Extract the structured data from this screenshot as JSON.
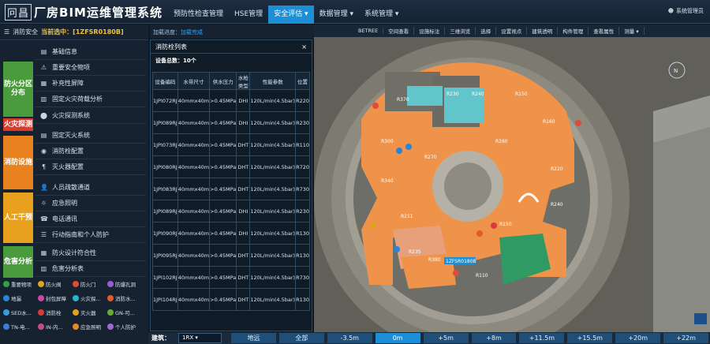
{
  "app": {
    "logo_mark": "冋昌",
    "title": "厂房BIM运维管理系统"
  },
  "nav": [
    {
      "label": "预防性检查管理"
    },
    {
      "label": "HSE管理"
    },
    {
      "label": "安全评估 ▾",
      "active": true
    },
    {
      "label": "数据管理 ▾"
    },
    {
      "label": "系统管理 ▾"
    }
  ],
  "user": {
    "label": "系统管理员"
  },
  "left": {
    "header_prefix": "消防安全",
    "current_label": "当前选中：[1ZFSR0180B]"
  },
  "categories": [
    {
      "label": "防火分区分布",
      "color": "#4a9b3c"
    },
    {
      "label": "火灾探测",
      "color": "#d83b2b"
    },
    {
      "label": "消防设施",
      "color": "#e8821f"
    },
    {
      "label": "人工干预",
      "color": "#e8a11f"
    },
    {
      "label": "危害分析",
      "color": "#4a9b3c"
    }
  ],
  "menu": [
    "基础信息",
    "重要安全物项",
    "补充性屏障",
    "固定火灾荷载分析",
    "火灾探测系统",
    "固定灭火系统",
    "消防栓配置",
    "灭火器配置",
    "人员疏散通道",
    "应急照明",
    "电话通讯",
    "行动指南和个人防护",
    "防火设计符合性",
    "危害分析表"
  ],
  "legend": [
    [
      "重要物项",
      "防火阀",
      "防火门",
      "防爆孔洞"
    ],
    [
      "地漏",
      "封包屏障",
      "火灾探...",
      "消防水..."
    ],
    [
      "SED水...",
      "消防栓",
      "灭火器",
      "GN-可..."
    ],
    [
      "TN-电...",
      "IN-内...",
      "应急照明",
      "个人防护"
    ]
  ],
  "legend_colors": [
    "#2fa34a",
    "#e0a21f",
    "#e04a3a",
    "#9b5ad6",
    "#2a84d6",
    "#c54aa0",
    "#2bb3c7",
    "#e05a2a",
    "#3a9bd6",
    "#d63a3a",
    "#e0a21f",
    "#6aa83a",
    "#3a7bd6",
    "#c54a8a",
    "#e08a2a",
    "#9a6ad6"
  ],
  "progress": {
    "label": "加载进度：",
    "value": "加载完成"
  },
  "tools": [
    "BETREE",
    "空间查看",
    "设施标注",
    "三维浏览",
    "选择",
    "设置视点",
    "建筑透明",
    "构件管理",
    "查看属性",
    "测量 ▾"
  ],
  "panel": {
    "title": "消防栓列表",
    "count_label": "设备总数：10个",
    "close": "×"
  },
  "table": {
    "headers": [
      "设备编码",
      "水带尺寸",
      "供水压力",
      "水枪类型",
      "性能参数",
      "位置"
    ],
    "rows": [
      [
        "1JPI072RJ",
        "40mmx40m",
        ">0.45MPa",
        "DHI",
        "120L/min(4.5bar)",
        "R220"
      ],
      [
        "1JPI089RJ",
        "40mmx40m",
        ">0.45MPa",
        "DHI",
        "120L/min(4.5bar)",
        "R230"
      ],
      [
        "1JPI073RJ",
        "40mmx40m",
        ">0.45MPa",
        "DHT",
        "120L/min(4.5bar)",
        "R110"
      ],
      [
        "1JPI080RJ",
        "40mmx40m",
        ">0.45MPa",
        "DHT",
        "120L/min(4.5bar)",
        "R720"
      ],
      [
        "1JPI083RJ",
        "40mmx40m",
        ">0.45MPa",
        "DHT",
        "120L/min(4.5bar)",
        "R730"
      ],
      [
        "1JPI089RJ",
        "40mmx40m",
        ">0.45MPa",
        "DHI",
        "120L/min(4.5bar)",
        "R230"
      ],
      [
        "1JPI090RJ",
        "40mmx40m",
        ">0.45MPa",
        "DHI",
        "120L/min(4.5bar)",
        "R130"
      ],
      [
        "1JPI095RJ",
        "40mmx40m",
        ">0.45MPa",
        "DHT",
        "120L/min(4.5bar)",
        "R130"
      ],
      [
        "1JPI102RJ",
        "40mmx40m",
        ">0.45MPa",
        "DHT",
        "120L/min(4.5bar)",
        "R730"
      ],
      [
        "1JPI104RJ",
        "40mmx40m",
        ">0.45MPa",
        "DHT",
        "120L/min(4.5bar)",
        "R130"
      ]
    ]
  },
  "map": {
    "selected_tag": "1ZFSR0180B"
  },
  "floorbar": {
    "label": "建筑：",
    "building": "1RX ▾",
    "buttons": [
      "地远",
      "全部",
      "-3.5m",
      "0m",
      "+5m",
      "+8m",
      "+11.5m",
      "+15.5m",
      "+20m",
      "+22m"
    ],
    "active": "0m"
  }
}
